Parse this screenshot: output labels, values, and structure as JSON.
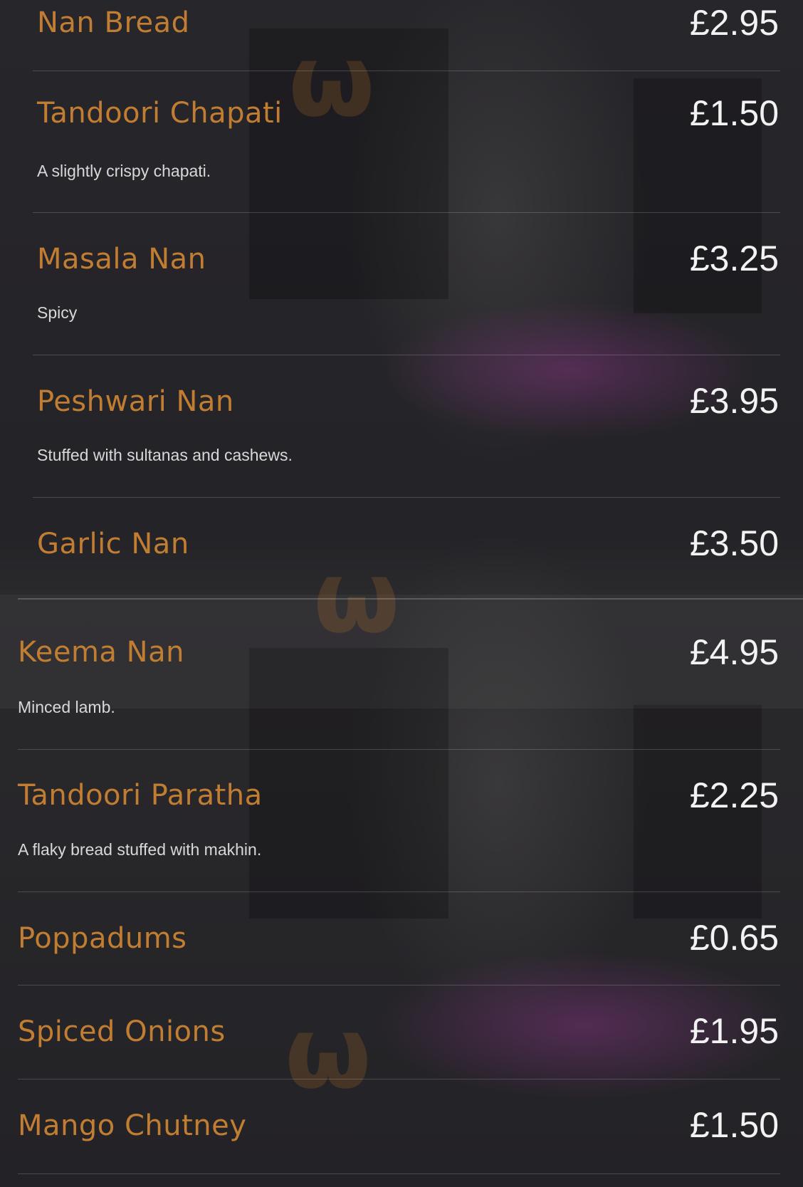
{
  "menu": {
    "items": [
      {
        "name": "Nan Bread",
        "price": "£2.95",
        "desc": ""
      },
      {
        "name": "Tandoori Chapati",
        "price": "£1.50",
        "desc": "A slightly crispy chapati."
      },
      {
        "name": "Masala Nan",
        "price": "£3.25",
        "desc": "Spicy"
      },
      {
        "name": "Peshwari Nan",
        "price": "£3.95",
        "desc": "Stuffed with sultanas and cashews."
      },
      {
        "name": "Garlic Nan",
        "price": "£3.50",
        "desc": ""
      },
      {
        "name": "Keema Nan",
        "price": "£4.95",
        "desc": "Minced lamb."
      },
      {
        "name": "Tandoori Paratha",
        "price": "£2.25",
        "desc": "A flaky bread stuffed with makhin."
      },
      {
        "name": "Poppadums",
        "price": "£0.65",
        "desc": ""
      },
      {
        "name": "Spiced Onions",
        "price": "£1.95",
        "desc": ""
      },
      {
        "name": "Mango Chutney",
        "price": "£1.50",
        "desc": ""
      }
    ]
  },
  "watermark": {
    "icon": "tripadvisor-watermark-icon"
  },
  "colors": {
    "item_name": "#c17d31",
    "price": "#f2f2f2",
    "description": "#d8d8d8",
    "background": "#201f22"
  }
}
